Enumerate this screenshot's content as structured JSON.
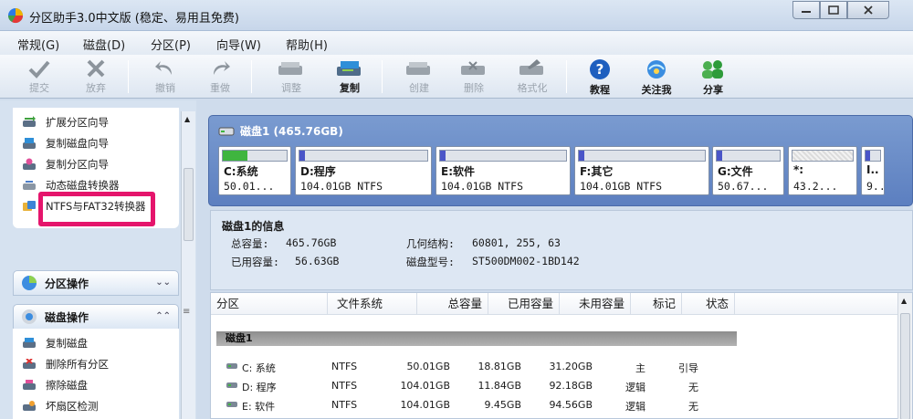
{
  "window": {
    "title": "分区助手3.0中文版 (稳定、易用且免费)",
    "controls": [
      "minimize-icon",
      "maximize-icon",
      "close-icon"
    ]
  },
  "menu": [
    "常规(G)",
    "磁盘(D)",
    "分区(P)",
    "向导(W)",
    "帮助(H)"
  ],
  "toolbar": [
    {
      "label": "提交",
      "icon": "check-icon",
      "enabled": false
    },
    {
      "label": "放弃",
      "icon": "x-icon",
      "enabled": false
    },
    {
      "label": "撤销",
      "icon": "undo-icon",
      "enabled": false
    },
    {
      "label": "重做",
      "icon": "redo-icon",
      "enabled": false
    },
    {
      "label": "调整",
      "icon": "resize-disk-icon",
      "enabled": false
    },
    {
      "label": "复制",
      "icon": "copy-disk-icon",
      "enabled": true
    },
    {
      "label": "创建",
      "icon": "create-disk-icon",
      "enabled": false
    },
    {
      "label": "删除",
      "icon": "delete-disk-icon",
      "enabled": false
    },
    {
      "label": "格式化",
      "icon": "format-disk-icon",
      "enabled": false
    },
    {
      "label": "教程",
      "icon": "help-icon",
      "enabled": true
    },
    {
      "label": "关注我",
      "icon": "follow-icon",
      "enabled": true
    },
    {
      "label": "分享",
      "icon": "share-icon",
      "enabled": true
    }
  ],
  "wizards": [
    {
      "label": "扩展分区向导",
      "icon": "extend-icon"
    },
    {
      "label": "复制磁盘向导",
      "icon": "copy-disk-icon"
    },
    {
      "label": "复制分区向导",
      "icon": "copy-partition-icon"
    },
    {
      "label": "动态磁盘转换器",
      "icon": "dynamic-disk-icon"
    },
    {
      "label": "NTFS与FAT32转换器",
      "icon": "convert-icon"
    }
  ],
  "sections": {
    "partition_ops": "分区操作",
    "disk_ops": "磁盘操作"
  },
  "disk_ops": [
    {
      "label": "复制磁盘",
      "icon": "copy-disk-icon"
    },
    {
      "label": "删除所有分区",
      "icon": "delete-all-icon"
    },
    {
      "label": "擦除磁盘",
      "icon": "wipe-disk-icon"
    },
    {
      "label": "坏扇区检测",
      "icon": "bad-sector-icon"
    }
  ],
  "disk_map": {
    "title": "磁盘1 (465.76GB)",
    "partitions": [
      {
        "name": "C:系统",
        "info": "50.01...",
        "used_fraction": 0.38,
        "color": "#3fb53f"
      },
      {
        "name": "D:程序",
        "info": "104.01GB NTFS",
        "used_fraction": 0.04,
        "color": "#4a55c8"
      },
      {
        "name": "E:软件",
        "info": "104.01GB NTFS",
        "used_fraction": 0.04,
        "color": "#4a55c8"
      },
      {
        "name": "F:其它",
        "info": "104.01GB NTFS",
        "used_fraction": 0.04,
        "color": "#4a55c8"
      },
      {
        "name": "G:文件",
        "info": "50.67...",
        "used_fraction": 0.08,
        "color": "#4a55c8"
      },
      {
        "name": "*:",
        "info": "43.2...",
        "used_fraction": 0,
        "color": "#dddddd"
      },
      {
        "name": "I..",
        "info": "9...",
        "used_fraction": 0.3,
        "color": "#4a55c8"
      }
    ]
  },
  "disk_info": {
    "title": "磁盘1的信息",
    "total_label": "总容量:",
    "total_value": "465.76GB",
    "used_label": "已用容量:",
    "used_value": "56.63GB",
    "geometry_label": "几何结构:",
    "geometry_value": "60801, 255, 63",
    "model_label": "磁盘型号:",
    "model_value": "ST500DM002-1BD142"
  },
  "table": {
    "headers": [
      "分区",
      "文件系统",
      "总容量",
      "已用容量",
      "未用容量",
      "标记",
      "状态"
    ],
    "group": "磁盘1",
    "rows": [
      {
        "partition": "C: 系统",
        "fs": "NTFS",
        "total": "50.01GB",
        "used": "18.81GB",
        "free": "31.20GB",
        "flag": "主",
        "status": "引导"
      },
      {
        "partition": "D: 程序",
        "fs": "NTFS",
        "total": "104.01GB",
        "used": "11.84GB",
        "free": "92.18GB",
        "flag": "逻辑",
        "status": "无"
      },
      {
        "partition": "E: 软件",
        "fs": "NTFS",
        "total": "104.01GB",
        "used": "9.45GB",
        "free": "94.56GB",
        "flag": "逻辑",
        "status": "无"
      }
    ]
  }
}
